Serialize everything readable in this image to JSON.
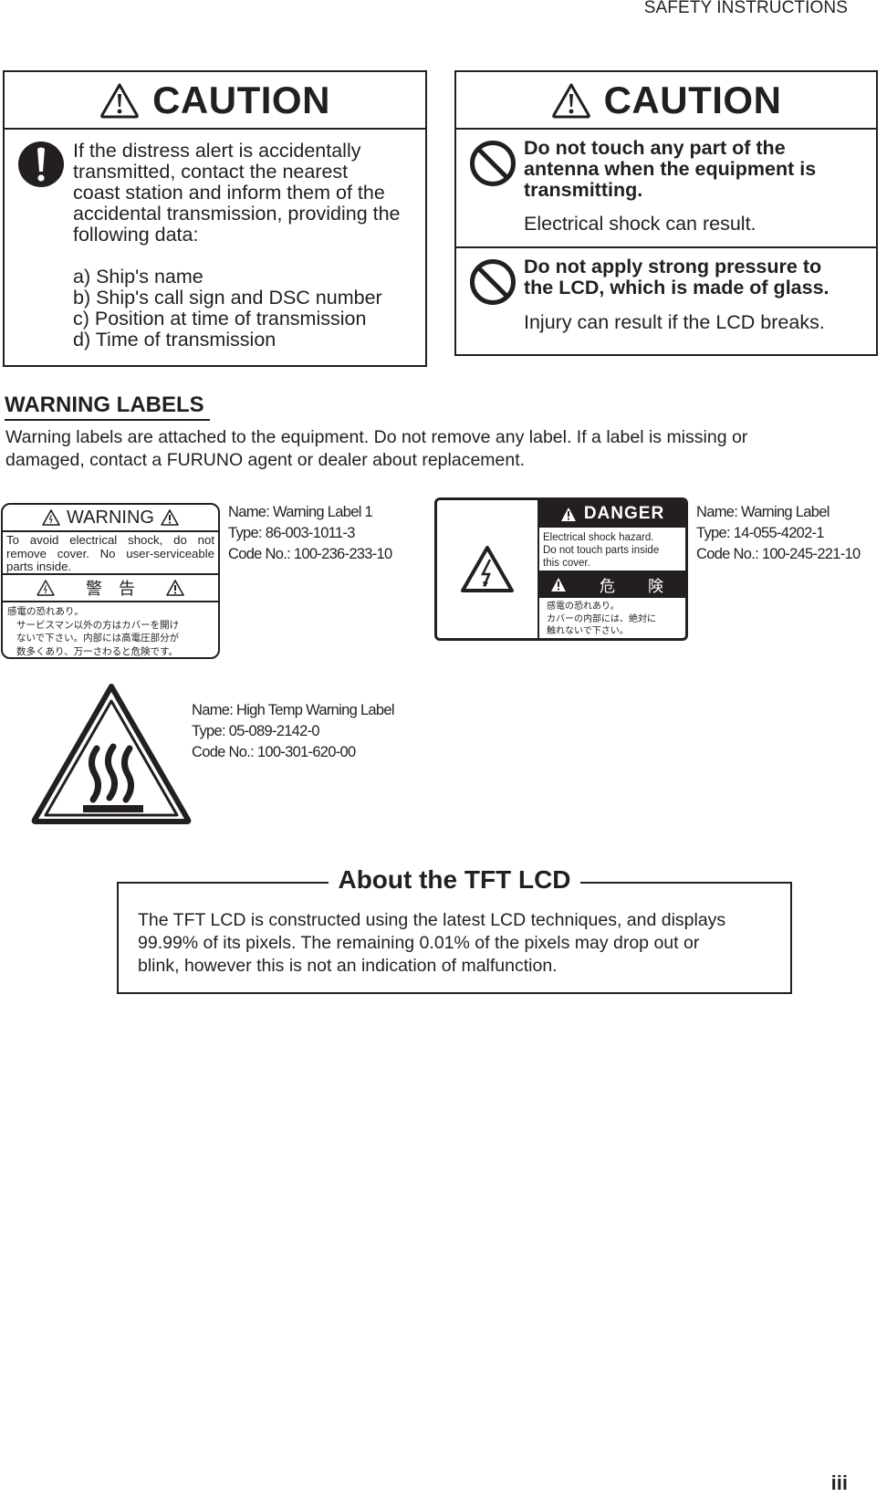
{
  "header": {
    "title": "SAFETY INSTRUCTIONS"
  },
  "page_number": "iii",
  "caution_left": {
    "heading": "CAUTION",
    "heading_icon": "warning-triangle-icon",
    "body_icon": "exclamation-circle-icon",
    "text_lines": [
      "If the distress alert is accidentally",
      "transmitted, contact the nearest",
      "coast station and inform them of the",
      "accidental transmission, providing the",
      "following data:"
    ],
    "list": [
      "a) Ship's name",
      "b) Ship's call sign and DSC number",
      "c) Position at time of transmission",
      "d) Time of transmission"
    ]
  },
  "caution_right": {
    "heading": "CAUTION",
    "heading_icon": "warning-triangle-icon",
    "rows": [
      {
        "icon": "prohibition-icon",
        "bold_lines": [
          "Do not touch any part of the",
          "antenna when the equipment is",
          "transmitting."
        ],
        "detail": "Electrical shock can result."
      },
      {
        "icon": "prohibition-icon",
        "bold_lines": [
          "Do not apply strong pressure to",
          "the LCD, which is made of glass."
        ],
        "detail": "Injury can result if the LCD breaks."
      }
    ]
  },
  "warning_labels": {
    "title": "WARNING LABELS",
    "description_lines": [
      "Warning labels are attached to the equipment. Do not remove any label. If a label is missing or",
      "damaged, contact a FURUNO agent or dealer about replacement."
    ],
    "labels": [
      {
        "sticker": {
          "heading": "WARNING",
          "text_lines": [
            "To avoid electrical shock, do not",
            "remove cover. No user-serviceable",
            "parts inside."
          ],
          "jp_heading": "警　告",
          "jp_lines": [
            "感電の恐れあり。",
            "サービスマン以外の方はカバーを開け",
            "ないで下さい。内部には高電圧部分が",
            "数多くあり、万一さわると危険です。"
          ]
        },
        "name": "Name: Warning Label 1",
        "type": "Type: 86-003-1011-3",
        "code": "Code No.: 100-236-233-10"
      },
      {
        "sticker": {
          "heading": "DANGER",
          "text_lines": [
            "Electrical shock hazard.",
            "Do not touch parts inside",
            "this cover."
          ],
          "jp_heading_chars": [
            "危",
            "険"
          ],
          "jp_lines": [
            "感電の恐れあり。",
            "カバーの内部には、絶対に",
            "触れないで下さい。"
          ]
        },
        "name": "Name: Warning Label",
        "type": "Type: 14-055-4202-1",
        "code": "Code No.: 100-245-221-10"
      },
      {
        "icon": "high-temperature-icon",
        "name": "Name: High Temp Warning Label",
        "type": "Type: 05-089-2142-0",
        "code": "Code No.: 100-301-620-00"
      }
    ]
  },
  "about_lcd": {
    "title": "About the TFT LCD",
    "text_lines": [
      "The TFT LCD is constructed using the latest LCD techniques, and displays",
      "99.99% of its pixels. The remaining 0.01% of the pixels may drop out or",
      "blink, however this is not an indication of malfunction."
    ]
  }
}
